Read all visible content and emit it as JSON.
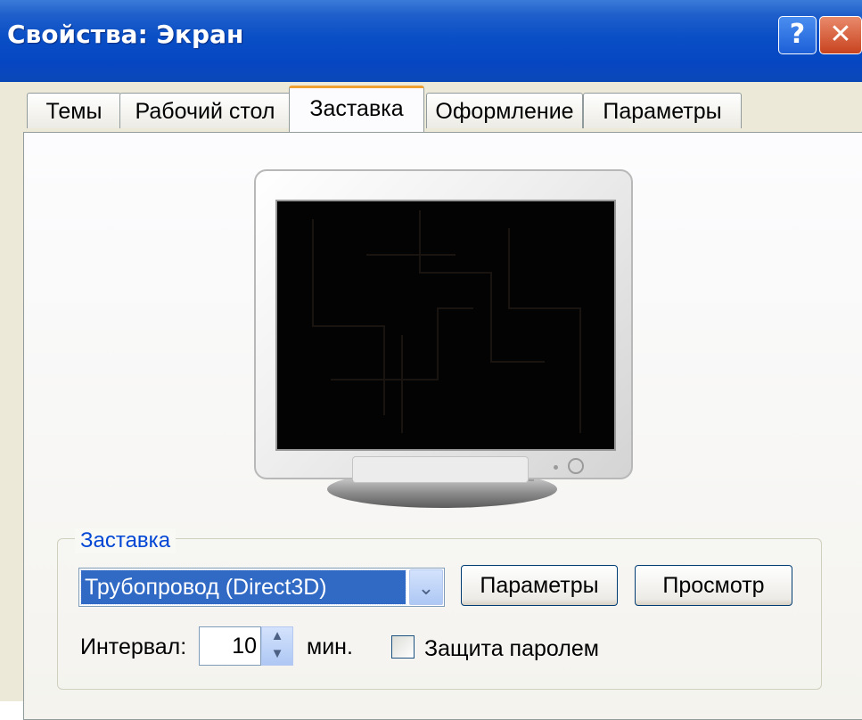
{
  "window": {
    "title": "Свойства: Экран",
    "help_icon": "?",
    "close_icon": "✕"
  },
  "tabs": [
    {
      "label": "Темы",
      "active": false
    },
    {
      "label": "Рабочий стол",
      "active": false
    },
    {
      "label": "Заставка",
      "active": true
    },
    {
      "label": "Оформление",
      "active": false
    },
    {
      "label": "Параметры",
      "active": false
    }
  ],
  "screensaver": {
    "group_label": "Заставка",
    "selected": "Трубопровод (Direct3D)",
    "dropdown_icon": "chevron-down",
    "settings_button": "Параметры",
    "preview_button": "Просмотр",
    "interval_label": "Интервал:",
    "interval_value": "10",
    "interval_unit": "мин.",
    "password_label": "Защита паролем",
    "password_checked": false
  },
  "colors": {
    "title_bar": "#0a4fc6",
    "accent_tab": "#f0a030",
    "selection": "#316ac5",
    "group_label": "#0046d5"
  }
}
